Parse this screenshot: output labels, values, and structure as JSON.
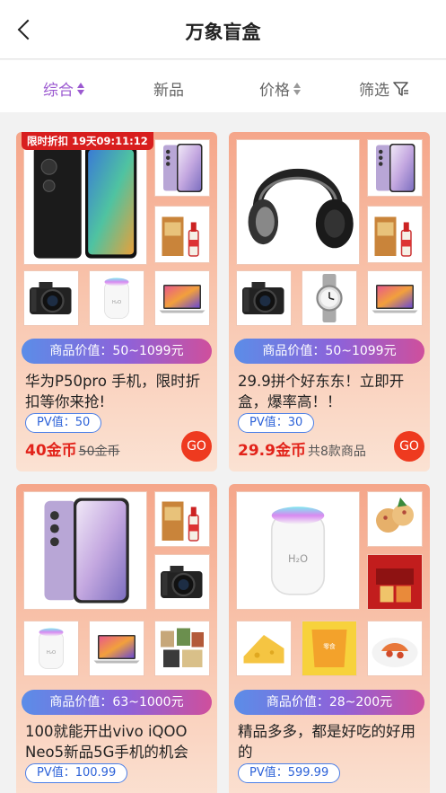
{
  "header": {
    "title": "万象盲盒",
    "back_icon": "chevron-left-icon"
  },
  "tabs": [
    {
      "label": "综合",
      "active": true
    },
    {
      "label": "新品",
      "active": false
    },
    {
      "label": "价格",
      "active": false
    },
    {
      "label": "筛选",
      "active": false
    }
  ],
  "colors": {
    "accent": "#9b59d0",
    "price": "#e2231a",
    "go": "#ee3a1f",
    "pv": "#2d62d8"
  },
  "cards": [
    {
      "flash_label": "限时折扣 19天09:11:12",
      "value_range": "商品价值：50~1099元",
      "description": "华为P50pro 手机，限时折扣等你来抢!",
      "pv": "PV值：50",
      "price": "40金币",
      "old_price": "50金币",
      "count": "",
      "go": "GO",
      "tiles": [
        "huawei-phone",
        "samsung-phone",
        "baijiu-bottle",
        "dslr-camera",
        "humidifier",
        "laptop"
      ]
    },
    {
      "value_range": "商品价值：50~1099元",
      "description": "29.9拼个好东东！立即开盒，爆率高！！",
      "pv": "PV值：30",
      "price": "29.9金币",
      "old_price": "",
      "count": "共8款商品",
      "go": "GO",
      "tiles": [
        "headphones",
        "samsung-phone",
        "baijiu-bottle",
        "dslr-camera",
        "wristwatch",
        "laptop"
      ]
    },
    {
      "value_range": "商品价值：63~1000元",
      "description": "100就能开出vivo iQOO Neo5新品5G手机的机会",
      "pv": "PV值：100.99",
      "tiles": [
        "samsung-phone",
        "baijiu-bottle",
        "dslr-camera",
        "humidifier",
        "laptop",
        "snack-box"
      ]
    },
    {
      "value_range": "商品价值：28~200元",
      "description": "精品多多，都是好吃的好用的",
      "pv": "PV值：599.99",
      "tiles": [
        "humidifier",
        "cookies",
        "snack-gift-box",
        "cheese",
        "snack-pack",
        "seafood-dish"
      ]
    }
  ]
}
